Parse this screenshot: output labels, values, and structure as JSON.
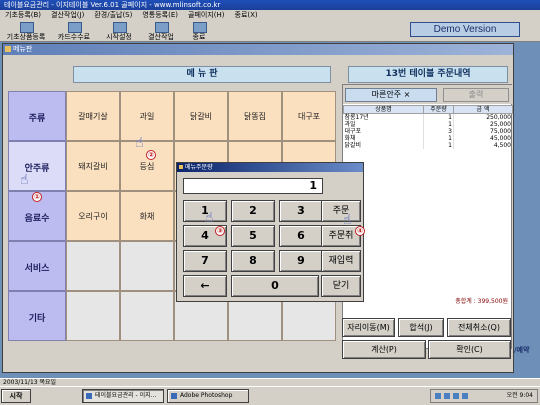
{
  "app": {
    "title": "테이블요금관리 - 이지테이블 Ver.6.01 골페이지 - www.mlinsoft.co.kr",
    "menubar": [
      "기초등록(B)",
      "결산작업(J)",
      "환경/출납(S)",
      "영통등록(E)",
      "골페이지(H)",
      "종료(X)"
    ],
    "toolbar": [
      "기초상품등록",
      "카드수수료",
      "시작설정",
      "결산작업",
      "종료"
    ],
    "demo_label": "Demo Version"
  },
  "menu_window": {
    "title": "메뉴판",
    "banner": "메  뉴  판",
    "order_banner": "13번 테이블 주문내역"
  },
  "categories": [
    {
      "label": "주류"
    },
    {
      "label": "안주류"
    },
    {
      "label": "음료수"
    },
    {
      "label": "서비스"
    },
    {
      "label": "기타"
    }
  ],
  "menu_items": [
    [
      "갈매기살",
      "과일",
      "닭갈비",
      "닭똥집",
      "대구포"
    ],
    [
      "돼지갈비",
      "등심",
      "",
      "",
      ""
    ],
    [
      "오리구이",
      "화채",
      "",
      "",
      ""
    ],
    [
      "",
      "",
      "",
      "",
      ""
    ],
    [
      "",
      "",
      "",
      "",
      ""
    ]
  ],
  "order_panel": {
    "tab_active": "마른안주 ×",
    "tab_print": "출력",
    "columns": [
      "상품명",
      "주문량",
      "금 액"
    ],
    "rows": [
      [
        "참롱17년",
        "1",
        "250,000"
      ],
      [
        "과일",
        "1",
        "25,000"
      ],
      [
        "대구포",
        "3",
        "75,000"
      ],
      [
        "화채",
        "1",
        "45,000"
      ],
      [
        "닭갈비",
        "1",
        "4,500"
      ]
    ],
    "total": "총합계 : 399,500원"
  },
  "actions": {
    "move": "자리이동(M)",
    "merge": "합석(J)",
    "cancel_all": "전체취소(Q)",
    "pay": "계산(P)",
    "confirm": "확인(C)"
  },
  "side_label": "/예약",
  "keypad": {
    "title": "메뉴주문량",
    "display": "1",
    "keys": [
      "1",
      "2",
      "3",
      "4",
      "5",
      "6",
      "7",
      "8",
      "9",
      "←",
      "0"
    ],
    "order": "주문",
    "order_cancel": "주문취",
    "reenter": "재입력",
    "close": "닫기"
  },
  "markers": [
    "①",
    "②",
    "③",
    "④"
  ],
  "date_status": "2003/11/13 목요일",
  "taskbar": {
    "start": "시작",
    "tasks": [
      "테이블요금관리 - 이지...",
      "Adobe Photoshop"
    ],
    "clock": "오전 9:04"
  }
}
